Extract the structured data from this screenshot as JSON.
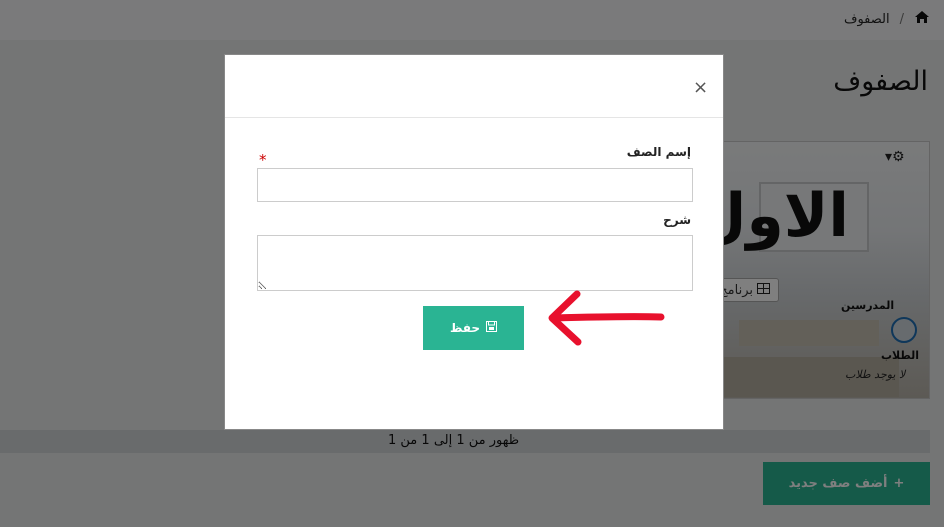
{
  "breadcrumb": {
    "home_icon": "home-icon",
    "current": "الصفوف",
    "separator": "/"
  },
  "page": {
    "title": "الصفوف"
  },
  "class_card": {
    "name": "الاول",
    "settings_icon": "gear-icon",
    "schedule_button": "برنامج",
    "teachers_label": "المدرسين",
    "students_label": "الطلاب",
    "no_students": "لا يوجد طلاب"
  },
  "pagination": {
    "summary": "ظهور من 1 إلى 1 من 1"
  },
  "add_button": {
    "label": "أضف صف جديد",
    "icon": "plus-icon"
  },
  "modal": {
    "close_label": "×",
    "class_name_label": "إسم الصف",
    "required_marker": "*",
    "class_name_value": "",
    "description_label": "شرح",
    "description_value": "",
    "save_label": "حفظ",
    "save_icon": "save-icon"
  },
  "colors": {
    "accent": "#2ab493",
    "arrow": "#e8112d",
    "required": "#cc0000"
  }
}
